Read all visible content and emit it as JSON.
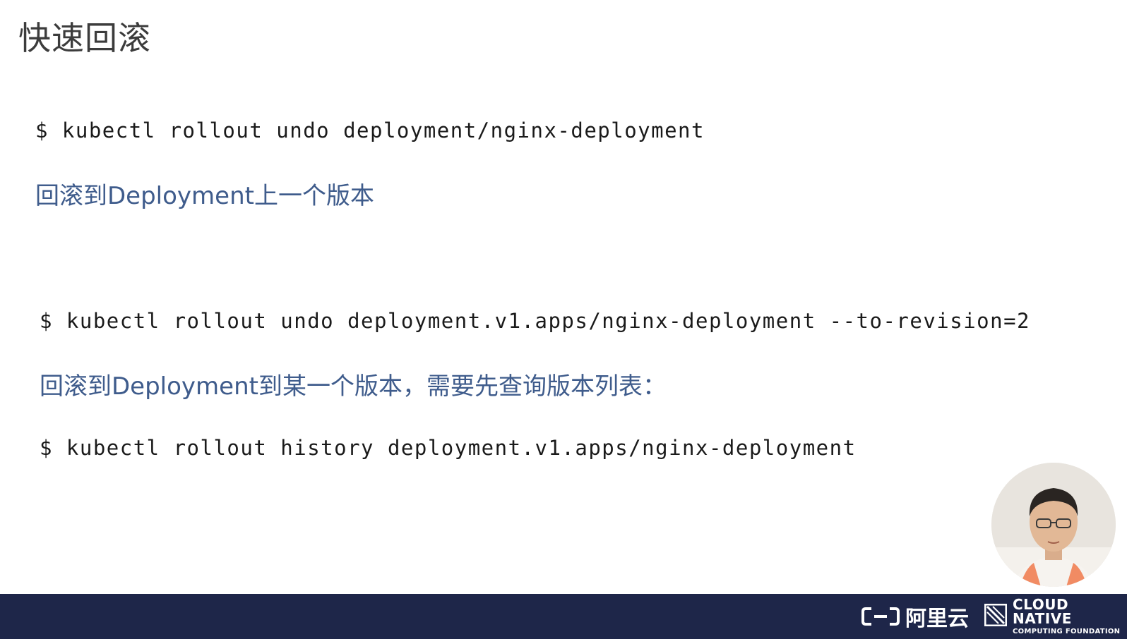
{
  "slide": {
    "title": "快速回滚",
    "commands": [
      "$ kubectl rollout undo deployment/nginx-deployment",
      "$ kubectl rollout undo deployment.v1.apps/nginx-deployment --to-revision=2",
      "$ kubectl rollout history deployment.v1.apps/nginx-deployment"
    ],
    "notes": [
      "回滚到Deployment上一个版本",
      "回滚到Deployment到某一个版本，需要先查询版本列表："
    ]
  },
  "footer": {
    "aliyun_name": "阿里云",
    "cncf_line1": "CLOUD NATIVE",
    "cncf_line2": "COMPUTING FOUNDATION",
    "background_color": "#1e2649"
  },
  "icons": {
    "aliyun_logo": "aliyun-logo-icon",
    "cncf_logo": "cncf-logo-icon",
    "presenter": "presenter-video-icon"
  },
  "colors": {
    "note_text": "#3f5c8c",
    "command_text": "#1a1a1a",
    "title_text": "#3c3c3c"
  }
}
